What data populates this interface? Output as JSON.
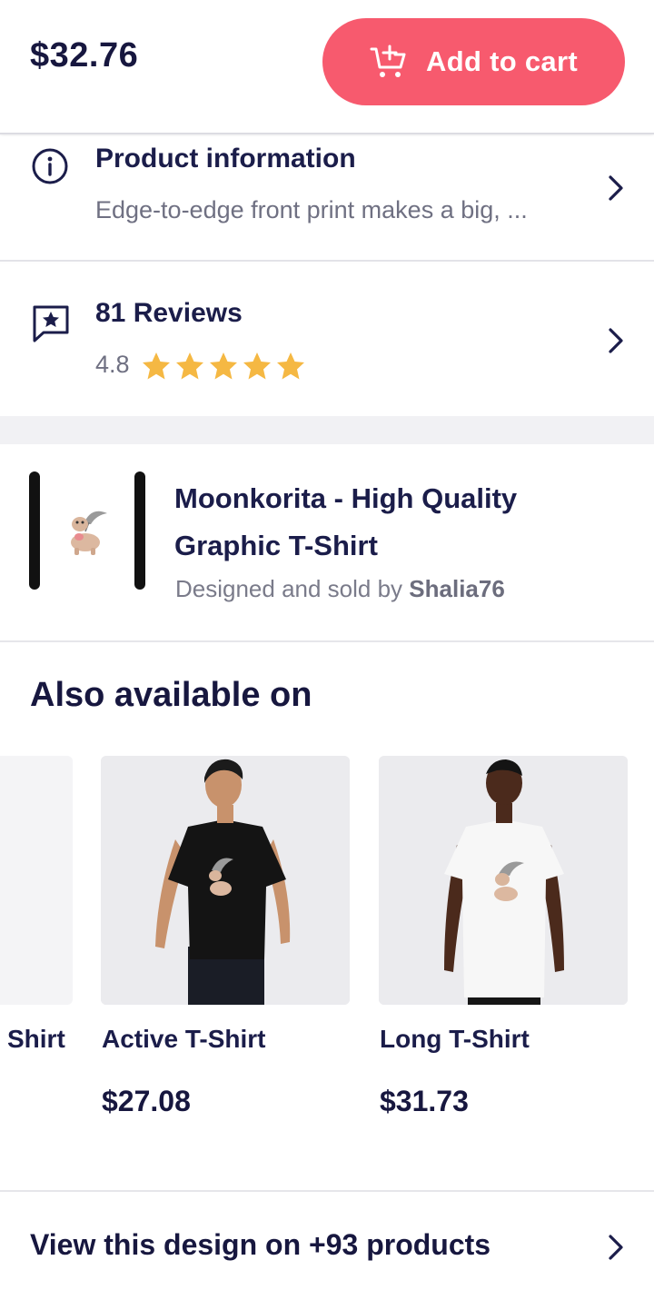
{
  "topbar": {
    "price": "$32.76",
    "add_to_cart_label": "Add to cart",
    "accent_color": "#f75a6e"
  },
  "product_info": {
    "title": "Product information",
    "summary": "Edge-to-edge front print makes a big, ..."
  },
  "reviews": {
    "title": "81 Reviews",
    "rating": "4.8",
    "stars_filled": 5,
    "star_color": "#f5b843"
  },
  "design": {
    "title": "Moonkorita - High Quality Graphic T-Shirt",
    "sold_by_prefix": "Designed and sold by ",
    "artist": "Shalia76"
  },
  "also_available": {
    "heading": "Also available on",
    "partial_card_name": "Shirt",
    "products": [
      {
        "name": "Active T-Shirt",
        "price": "$27.08",
        "shirt_color": "#141414"
      },
      {
        "name": "Long T-Shirt",
        "price": "$31.73",
        "shirt_color": "#f7f7f7"
      }
    ]
  },
  "view_more": {
    "label": "View this design on +93 products"
  }
}
